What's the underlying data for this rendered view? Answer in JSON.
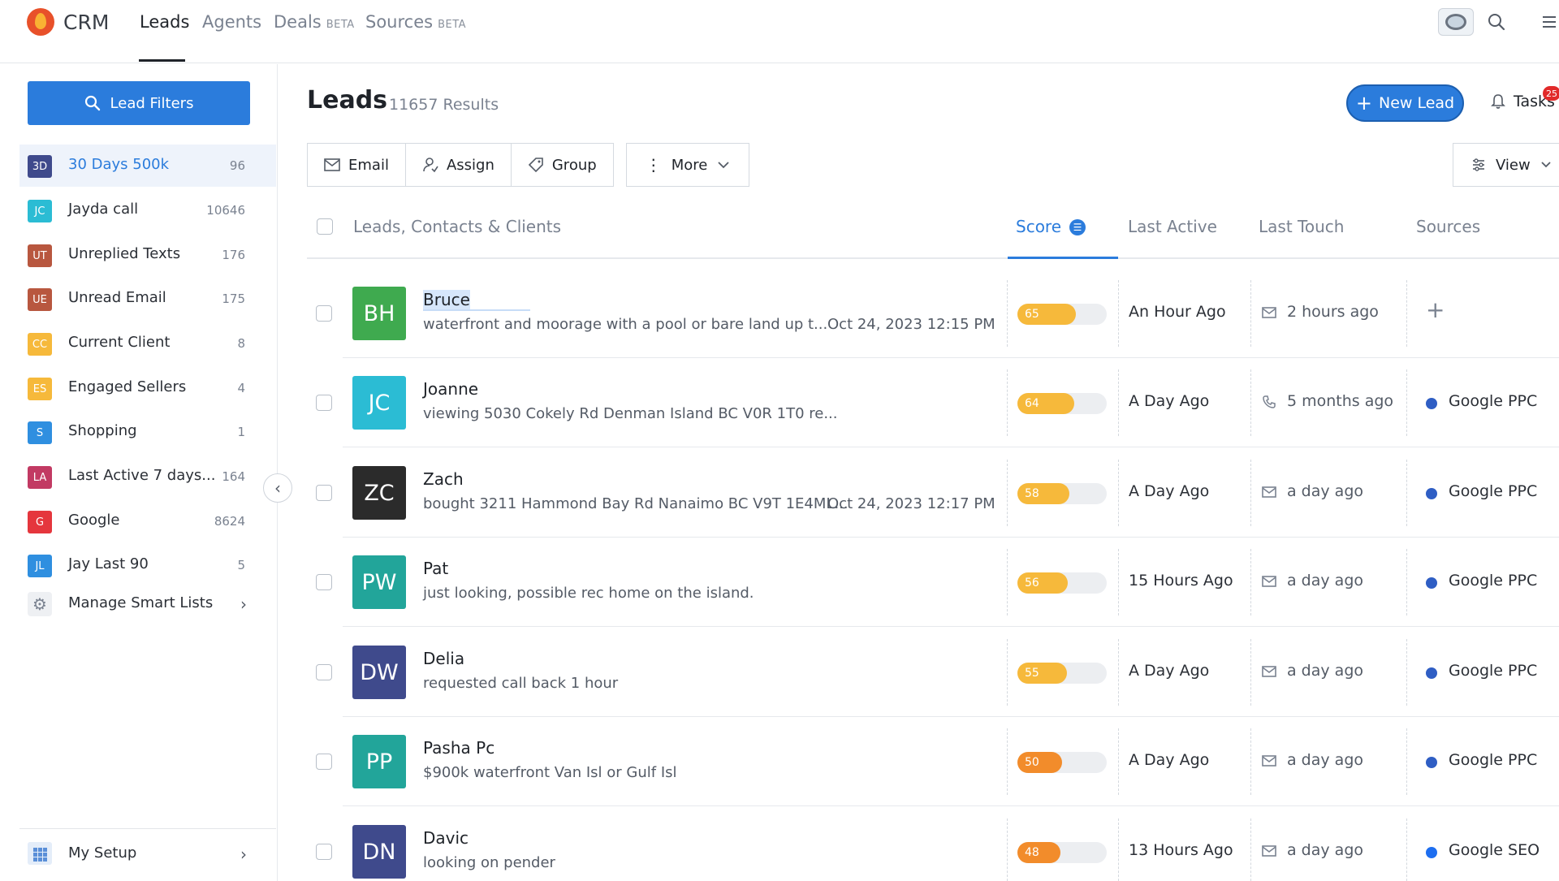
{
  "nav": {
    "brand": "CRM",
    "links": [
      {
        "label": "Leads",
        "badge": ""
      },
      {
        "label": "Agents",
        "badge": ""
      },
      {
        "label": "Deals",
        "badge": "BETA"
      },
      {
        "label": "Sources",
        "badge": "BETA"
      }
    ]
  },
  "sidebar": {
    "filters_label": "Lead Filters",
    "smart_lists": [
      {
        "abbr": "3D",
        "label": "30 Days 500k",
        "count": "96",
        "color": "#3f4a8c"
      },
      {
        "abbr": "JC",
        "label": "Jayda call",
        "count": "10646",
        "color": "#2bbcd4"
      },
      {
        "abbr": "UT",
        "label": "Unreplied Texts",
        "count": "176",
        "color": "#b8573f"
      },
      {
        "abbr": "UE",
        "label": "Unread Email",
        "count": "175",
        "color": "#b8573f"
      },
      {
        "abbr": "CC",
        "label": "Current Client",
        "count": "8",
        "color": "#f6b93b"
      },
      {
        "abbr": "ES",
        "label": "Engaged Sellers",
        "count": "4",
        "color": "#f6b93b"
      },
      {
        "abbr": "S",
        "label": "Shopping",
        "count": "1",
        "color": "#2f8fe0"
      },
      {
        "abbr": "LA",
        "label": "Last Active 7 days...",
        "count": "164",
        "color": "#c23a63"
      },
      {
        "abbr": "G",
        "label": "Google",
        "count": "8624",
        "color": "#e5363d"
      },
      {
        "abbr": "JL",
        "label": "Jay Last 90",
        "count": "5",
        "color": "#2f8fe0"
      }
    ],
    "manage_label": "Manage Smart Lists",
    "setup_label": "My Setup"
  },
  "header": {
    "title": "Leads",
    "results": "11657 Results",
    "new_lead": "New Lead",
    "tasks": "Tasks",
    "tasks_badge": "25"
  },
  "toolbar": {
    "email": "Email",
    "assign": "Assign",
    "group": "Group",
    "more": "More",
    "view": "View"
  },
  "columns": {
    "leads": "Leads, Contacts & Clients",
    "score": "Score",
    "last_active": "Last Active",
    "last_touch": "Last Touch",
    "sources": "Sources"
  },
  "colors": {
    "accent": "#2b7cdc",
    "score_high": "#f6b93b",
    "score_low": "#f28c2b"
  },
  "leads": [
    {
      "initials": "BH",
      "name": "Bruce",
      "desc": "waterfront and moorage with a pool or bare land up t...",
      "date": "Oct 24, 2023 12:15 PM",
      "score": 65,
      "score_color": "#f6b93b",
      "avatar_color": "#3faa4f",
      "last_active": "An Hour Ago",
      "touch_icon": "mail-icon",
      "last_touch": "2 hours ago",
      "source": "",
      "source_plus": "+"
    },
    {
      "initials": "JC",
      "name": "Joanne",
      "desc": "viewing 5030 Cokely Rd Denman Island BC V0R 1T0 re...",
      "date": "",
      "score": 64,
      "score_color": "#f6b93b",
      "avatar_color": "#2bbcd4",
      "last_active": "A Day Ago",
      "touch_icon": "phone-icon",
      "last_touch": "5 months ago",
      "source": "Google PPC",
      "source_plus": ""
    },
    {
      "initials": "ZC",
      "name": "Zach",
      "desc": "bought 3211 Hammond Bay Rd Nanaimo BC V9T 1E4ML...",
      "date": "Oct 24, 2023 12:17 PM",
      "score": 58,
      "score_color": "#f6b93b",
      "avatar_color": "#2b2b2b",
      "last_active": "A Day Ago",
      "touch_icon": "mail-icon",
      "last_touch": "a day ago",
      "source": "Google PPC",
      "source_plus": ""
    },
    {
      "initials": "PW",
      "name": "Pat",
      "desc": "just looking, possible rec home on the island.",
      "date": "",
      "score": 56,
      "score_color": "#f6b93b",
      "avatar_color": "#22a59a",
      "last_active": "15 Hours Ago",
      "touch_icon": "mail-icon",
      "last_touch": "a day ago",
      "source": "Google PPC",
      "source_plus": ""
    },
    {
      "initials": "DW",
      "name": "Delia",
      "desc": "requested call back 1 hour",
      "date": "",
      "score": 55,
      "score_color": "#f6b93b",
      "avatar_color": "#3f4a8c",
      "last_active": "A Day Ago",
      "touch_icon": "mail-icon",
      "last_touch": "a day ago",
      "source": "Google PPC",
      "source_plus": ""
    },
    {
      "initials": "PP",
      "name": "Pasha Pc",
      "desc": "$900k waterfront Van Isl or Gulf Isl",
      "date": "",
      "score": 50,
      "score_color": "#f28c2b",
      "avatar_color": "#22a59a",
      "last_active": "A Day Ago",
      "touch_icon": "mail-icon",
      "last_touch": "a day ago",
      "source": "Google PPC",
      "source_plus": ""
    },
    {
      "initials": "DN",
      "name": "Davic",
      "desc": "looking on pender",
      "date": "",
      "score": 48,
      "score_color": "#f28c2b",
      "avatar_color": "#3f4a8c",
      "last_active": "13 Hours Ago",
      "touch_icon": "mail-icon",
      "last_touch": "a day ago",
      "source": "Google SEO",
      "source_plus": ""
    }
  ]
}
